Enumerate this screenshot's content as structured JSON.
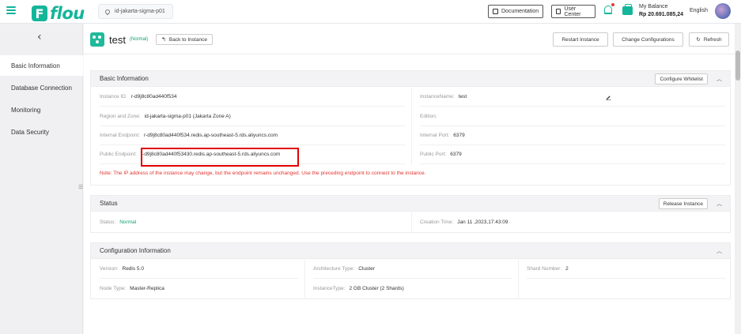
{
  "topbar": {
    "logo_letter": "F",
    "logo_text": "flou",
    "region": "id-jakarta-sigma-p01",
    "documentation": "Documentation",
    "user_center": "User Center",
    "balance_label": "My Balance",
    "balance_value": "Rp 20.691.085,24",
    "language": "English"
  },
  "sidebar": {
    "back": "‹",
    "items": [
      {
        "label": "Basic Information"
      },
      {
        "label": "Database Connection"
      },
      {
        "label": "Monitoring"
      },
      {
        "label": "Data Security"
      }
    ]
  },
  "header": {
    "title": "test",
    "status": "(Normal)",
    "back_button": "Back to Instance",
    "restart": "Restart Instance",
    "change_config": "Change Configurations",
    "refresh": "Refresh"
  },
  "basic_info": {
    "title": "Basic Information",
    "configure_whitelist": "Configure Whitelist",
    "instance_id_label": "Instance ID:",
    "instance_id": "r-d9j8c80ad440f534",
    "instance_name_label": "InstanceName:",
    "instance_name": "test",
    "region_zone_label": "Region and Zone:",
    "region_zone": "id-jakarta-sigma-p01 (Jakarta Zone A)",
    "edition_label": "Edition:",
    "edition": "",
    "internal_endpoint_label": "Internal Endpoint:",
    "internal_endpoint": "r-d9j8c80ad440f534.redis.ap-southeast-5.rds.aliyuncs.com",
    "internal_port_label": "Internal Port:",
    "internal_port": "6379",
    "public_endpoint_label": "Public Endpoint:",
    "public_endpoint": "r-d9j8c80ad440f53430.redis.ap-southeast-5.rds.aliyuncs.com",
    "public_port_label": "Public Port:",
    "public_port": "6379",
    "note": "Note:  The IP address of the instance may change, but the endpoint remains unchanged. Use the preceding endpoint to connect to the instance."
  },
  "status": {
    "title": "Status",
    "release": "Release Instance",
    "status_label": "Status:",
    "status_value": "Normal",
    "creation_label": "Creation Time:",
    "creation_value": "Jan 11 ,2023,17:43:09"
  },
  "config": {
    "title": "Configuration Information",
    "version_label": "Version:",
    "version": "Redis 5.0",
    "arch_label": "Architecture Type:",
    "arch": "Cluster",
    "shard_label": "Shard Number:",
    "shard": "2",
    "node_label": "Node Type:",
    "node": "Master-Replica",
    "type_label": "InstanceType:",
    "type": "2 GB Cluster (2 Shards)"
  },
  "colors": {
    "brand": "#15b59a",
    "status_green": "#15a06a",
    "note_red": "#e3342f",
    "highlight_red": "#e00000"
  }
}
